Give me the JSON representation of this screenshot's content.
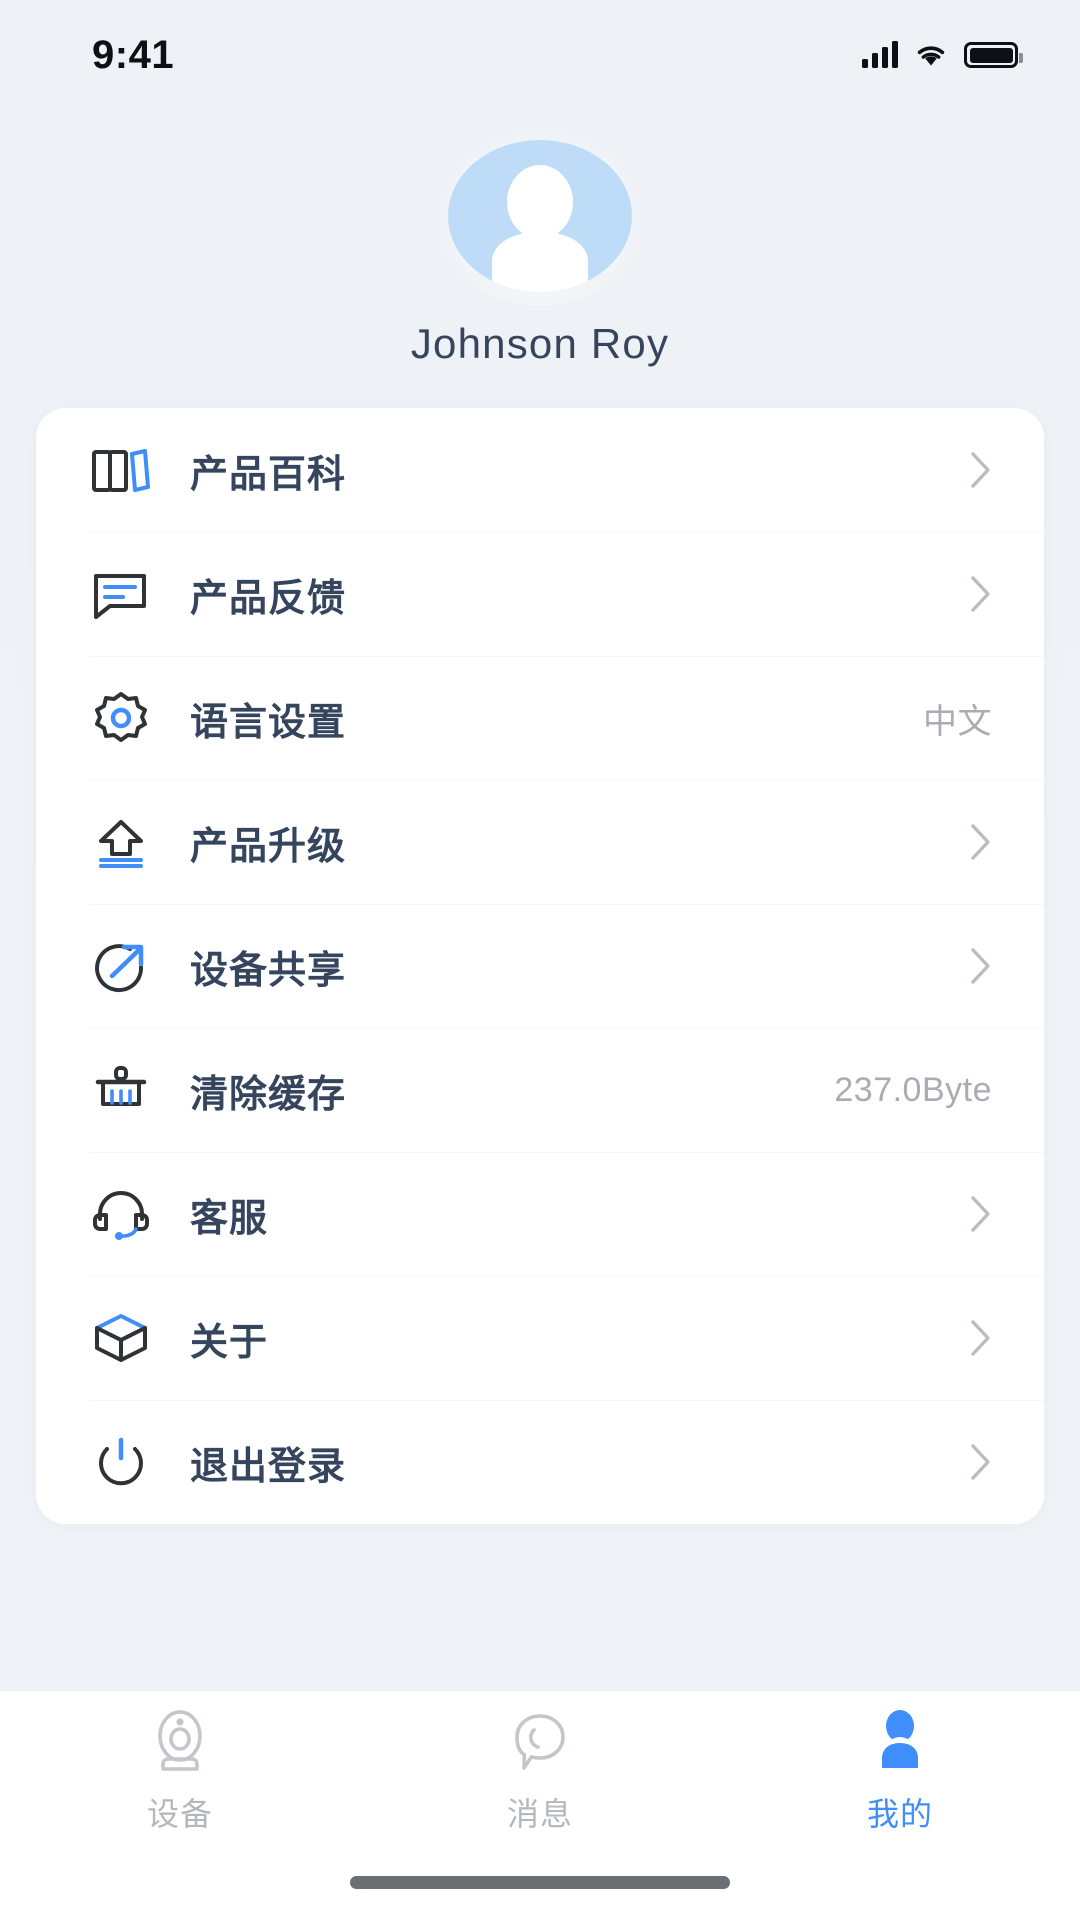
{
  "status_bar": {
    "time": "9:41",
    "signal_icon": "signal-bars-icon",
    "wifi_icon": "wifi-icon",
    "battery_icon": "battery-icon"
  },
  "profile": {
    "avatar_icon": "user-avatar-icon",
    "username": "Johnson Roy",
    "avatar_bg": "#bedcf7"
  },
  "menu": {
    "items": [
      {
        "icon": "books-icon",
        "label": "产品百科",
        "value": "",
        "chevron": true
      },
      {
        "icon": "feedback-icon",
        "label": "产品反馈",
        "value": "",
        "chevron": true
      },
      {
        "icon": "gear-icon",
        "label": "语言设置",
        "value": "中文",
        "chevron": false
      },
      {
        "icon": "upgrade-icon",
        "label": "产品升级",
        "value": "",
        "chevron": true
      },
      {
        "icon": "share-icon",
        "label": "设备共享",
        "value": "",
        "chevron": true
      },
      {
        "icon": "broom-icon",
        "label": "清除缓存",
        "value": "237.0Byte",
        "chevron": false
      },
      {
        "icon": "headset-icon",
        "label": "客服",
        "value": "",
        "chevron": true
      },
      {
        "icon": "cube-icon",
        "label": "关于",
        "value": "",
        "chevron": true
      },
      {
        "icon": "power-icon",
        "label": "退出登录",
        "value": "",
        "chevron": true
      }
    ]
  },
  "tabbar": {
    "tabs": [
      {
        "icon": "camera-device-icon",
        "label": "设备",
        "active": false
      },
      {
        "icon": "message-bubble-icon",
        "label": "消息",
        "active": false
      },
      {
        "icon": "person-icon",
        "label": "我的",
        "active": true
      }
    ],
    "active_color": "#3f8efc",
    "inactive_color": "#b4b8bd"
  },
  "colors": {
    "accent": "#3f8efc",
    "label": "#35455d",
    "value": "#a9adb3",
    "page_bg": "#eef2f6",
    "card_bg": "#ffffff"
  }
}
